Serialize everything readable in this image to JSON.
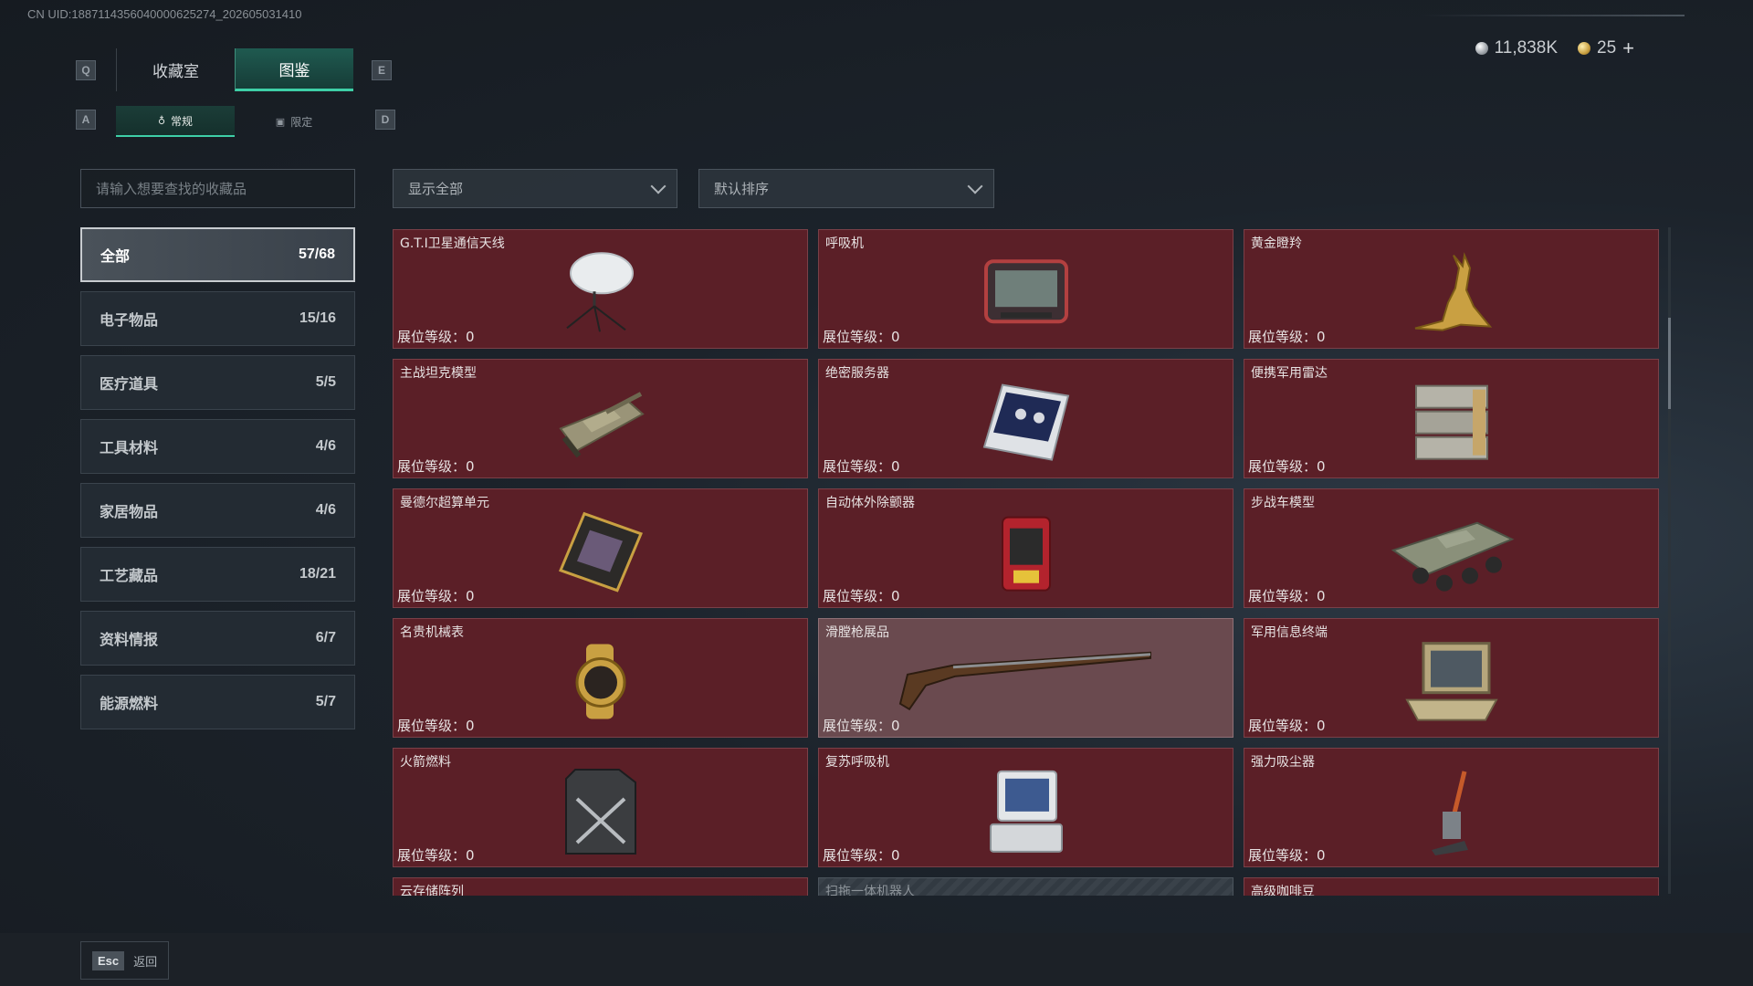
{
  "uid": "CN UID:1887114356040000625274_202605031410",
  "currency": {
    "silver": "11,838K",
    "gold": "25",
    "plus": "+"
  },
  "keys": {
    "q": "Q",
    "e": "E",
    "a": "A",
    "d": "D"
  },
  "tabs": [
    {
      "label": "收藏室",
      "active": false
    },
    {
      "label": "图鉴",
      "active": true
    }
  ],
  "subtabs": [
    {
      "label": "常规",
      "active": true
    },
    {
      "label": "限定",
      "active": false
    }
  ],
  "search": {
    "placeholder": "请输入想要查找的收藏品"
  },
  "filters": {
    "show": "显示全部",
    "sort": "默认排序"
  },
  "categories": [
    {
      "label": "全部",
      "count": "57/68",
      "active": true
    },
    {
      "label": "电子物品",
      "count": "15/16"
    },
    {
      "label": "医疗道具",
      "count": "5/5"
    },
    {
      "label": "工具材料",
      "count": "4/6"
    },
    {
      "label": "家居物品",
      "count": "4/6"
    },
    {
      "label": "工艺藏品",
      "count": "18/21"
    },
    {
      "label": "资料情报",
      "count": "6/7"
    },
    {
      "label": "能源燃料",
      "count": "5/7"
    }
  ],
  "level_label": "展位等级：0",
  "items": [
    {
      "name": "G.T.I卫星通信天线",
      "icon": "satellite-dish-icon"
    },
    {
      "name": "呼吸机",
      "icon": "ventilator-icon"
    },
    {
      "name": "黄金瞪羚",
      "icon": "golden-gazelle-icon"
    },
    {
      "name": "主战坦克模型",
      "icon": "tank-model-icon"
    },
    {
      "name": "绝密服务器",
      "icon": "server-icon"
    },
    {
      "name": "便携军用雷达",
      "icon": "radar-icon"
    },
    {
      "name": "曼德尔超算单元",
      "icon": "supercompute-unit-icon"
    },
    {
      "name": "自动体外除颤器",
      "icon": "defibrillator-icon"
    },
    {
      "name": "步战车模型",
      "icon": "ifv-model-icon"
    },
    {
      "name": "名贵机械表",
      "icon": "watch-icon"
    },
    {
      "name": "滑膛枪展品",
      "icon": "musket-icon"
    },
    {
      "name": "军用信息终端",
      "icon": "terminal-icon"
    },
    {
      "name": "火箭燃料",
      "icon": "fuel-can-icon"
    },
    {
      "name": "复苏呼吸机",
      "icon": "resuscitator-icon"
    },
    {
      "name": "强力吸尘器",
      "icon": "vacuum-icon"
    },
    {
      "name": "云存储阵列",
      "icon": "storage-array-icon"
    },
    {
      "name": "扫拖一体机器人",
      "icon": "robot-vacuum-icon"
    },
    {
      "name": "高级咖啡豆",
      "icon": "coffee-beans-icon"
    }
  ],
  "footer": {
    "esc_key": "Esc",
    "back": "返回"
  }
}
